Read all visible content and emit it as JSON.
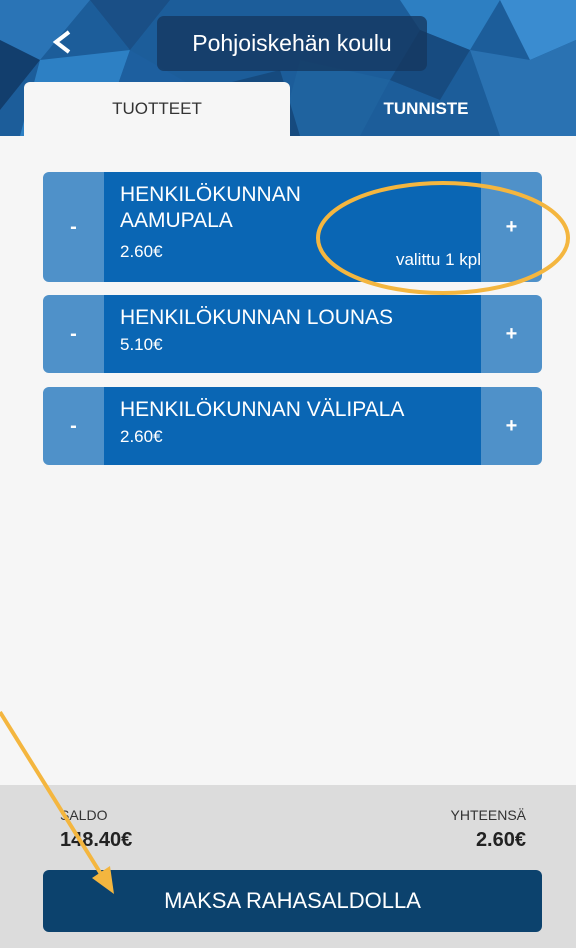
{
  "header": {
    "title": "Pohjoiskehän koulu",
    "back_symbol": "<"
  },
  "tabs": [
    {
      "label": "TUOTTEET",
      "active": true
    },
    {
      "label": "TUNNISTE",
      "active": false
    }
  ],
  "products": [
    {
      "name": "HENKILÖKUNNAN AAMUPALA",
      "price": "2.60€",
      "selected": "valittu 1 kpl"
    },
    {
      "name": "HENKILÖKUNNAN LOUNAS",
      "price": "5.10€"
    },
    {
      "name": "HENKILÖKUNNAN VÄLIPALA",
      "price": "2.60€"
    }
  ],
  "controls": {
    "minus": "-",
    "plus": "+"
  },
  "footer": {
    "saldo_label": "SALDO",
    "saldo_value": "148.40€",
    "total_label": "YHTEENSÄ",
    "total_value": "2.60€",
    "pay_label": "MAKSA RAHASALDOLLA"
  },
  "colors": {
    "header_bg": "#1c5d9a",
    "product_bg": "#0a66b4",
    "side_button_bg": "#4f91c9",
    "pay_button_bg": "#0c426d",
    "annotation": "#f4b63f"
  }
}
